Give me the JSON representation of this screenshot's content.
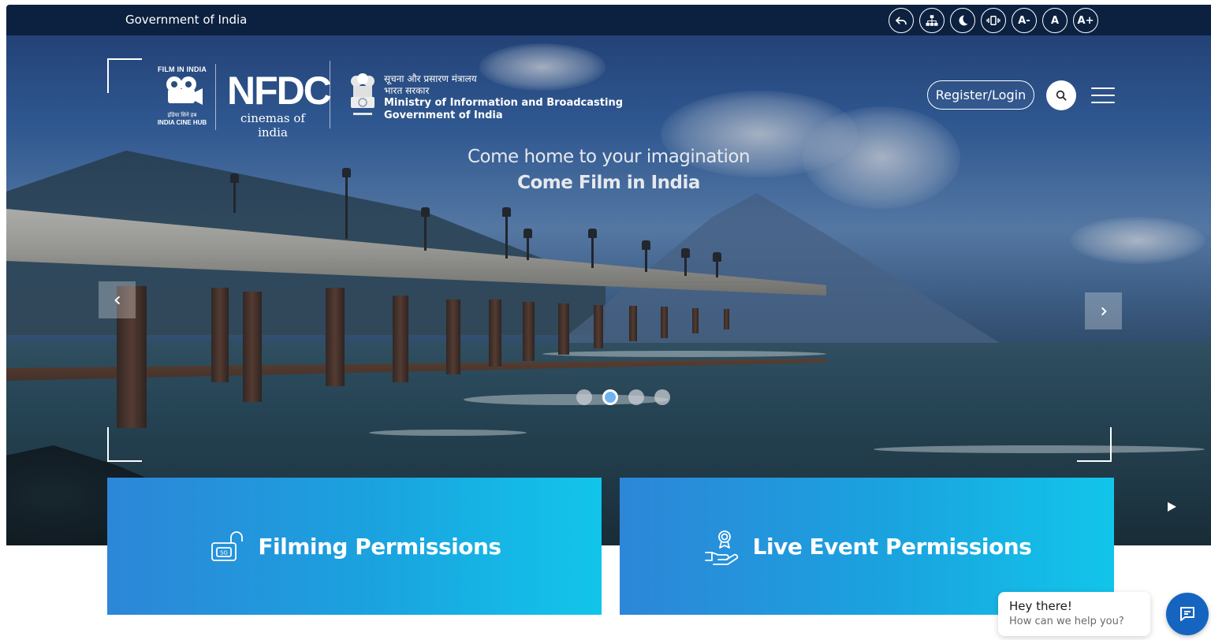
{
  "gov_bar": {
    "title": "Government of India",
    "tools": [
      {
        "icon": "undo-icon",
        "label": ""
      },
      {
        "icon": "sitemap-icon",
        "label": ""
      },
      {
        "icon": "dark-mode-icon",
        "label": ""
      },
      {
        "icon": "screen-reader-icon",
        "label": ""
      },
      {
        "icon": "font-decrease",
        "label": "A-"
      },
      {
        "icon": "font-reset",
        "label": "A"
      },
      {
        "icon": "font-increase",
        "label": "A+"
      }
    ]
  },
  "header": {
    "film_logo": {
      "top": "FILM IN INDIA",
      "hindi": "इंडिया सिने हब",
      "bottom": "INDIA CINE HUB"
    },
    "nfdc_logo": {
      "word": "NFDC",
      "tagline": "cinemas of india"
    },
    "ministry": {
      "hindi_line1": "सूचना और प्रसारण मंत्रालय",
      "hindi_line2": "भारत सरकार",
      "english_line1": "Ministry of Information and Broadcasting",
      "english_line2": "Government of India"
    },
    "register_label": "Register/Login"
  },
  "hero": {
    "tagline_1": "Come home to your imagination",
    "tagline_2": "Come Film in India",
    "slides_count": 4,
    "active_slide": 2
  },
  "cards": {
    "filming": "Filming Permissions",
    "live_event": "Live Event Permissions"
  },
  "chat": {
    "greeting": "Hey there!",
    "prompt": "How can we help you?"
  },
  "colors": {
    "gov_bar_bg": "#0c2140",
    "card_gradient_start": "#2d86d8",
    "card_gradient_end": "#12c5ea",
    "chat_fab": "#1565c0",
    "active_dot": "#6fb2ee"
  }
}
